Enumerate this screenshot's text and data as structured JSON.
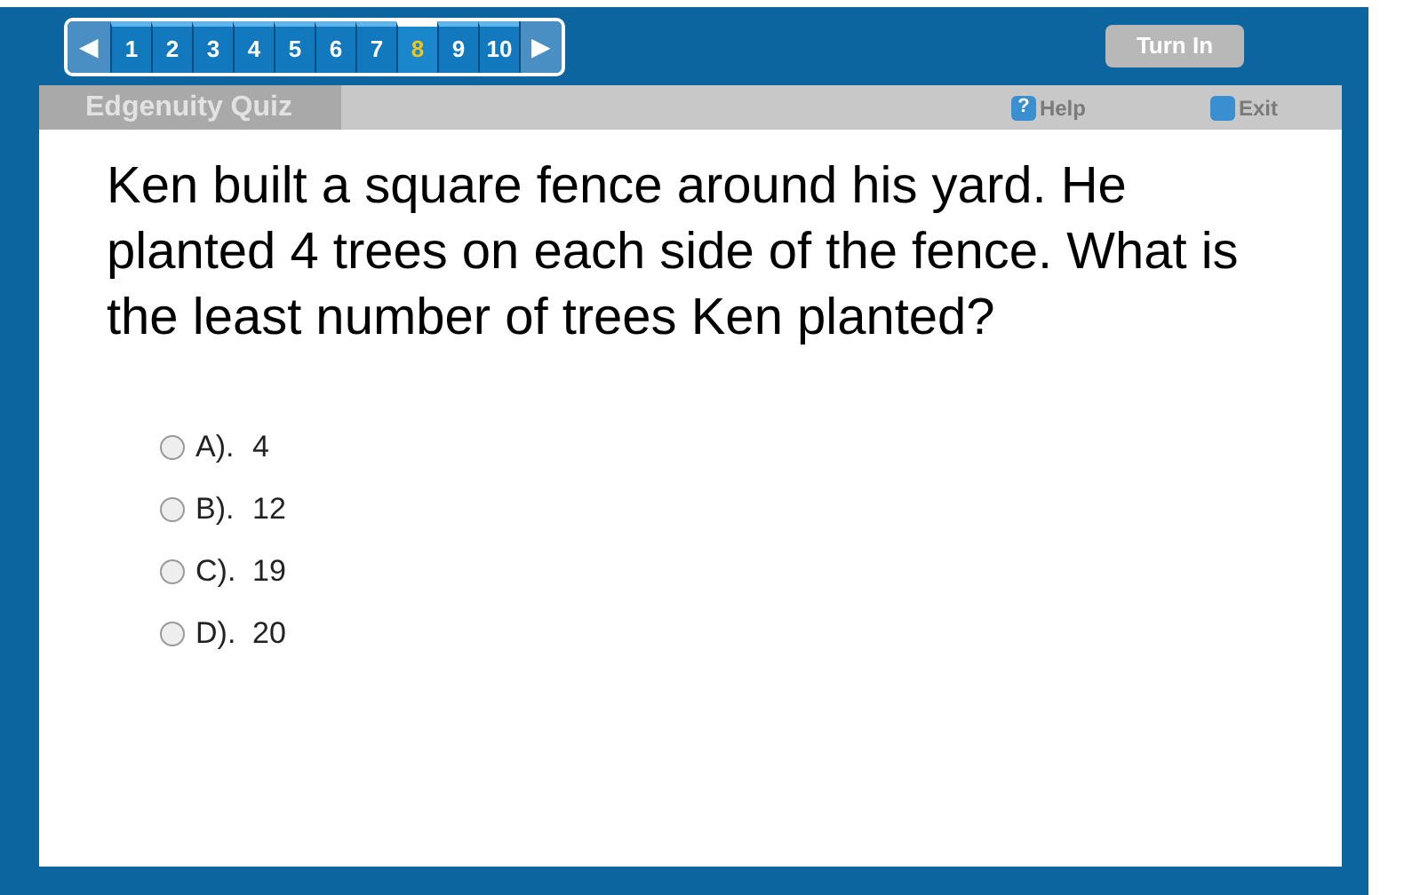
{
  "pager": {
    "prev": "◀",
    "next": "▶",
    "pages": [
      {
        "label": "1",
        "selected": false
      },
      {
        "label": "2",
        "selected": false
      },
      {
        "label": "3",
        "selected": false
      },
      {
        "label": "4",
        "selected": false
      },
      {
        "label": "5",
        "selected": false
      },
      {
        "label": "6",
        "selected": false
      },
      {
        "label": "7",
        "selected": false
      },
      {
        "label": "8",
        "selected": true
      },
      {
        "label": "9",
        "selected": false
      },
      {
        "label": "10",
        "selected": false
      }
    ]
  },
  "turn_in": "Turn In",
  "header": {
    "title": "Edgenuity Quiz",
    "help_icon": "?",
    "help": "Help",
    "exit": "Exit"
  },
  "question": "Ken built a square fence around his yard. He planted 4 trees on each side of the fence. What is the least number of trees Ken planted?",
  "options": [
    {
      "letter": "A).",
      "text": "4",
      "selected": false
    },
    {
      "letter": "B).",
      "text": "12",
      "selected": false
    },
    {
      "letter": "C).",
      "text": "19",
      "selected": false
    },
    {
      "letter": "D).",
      "text": "20",
      "selected": false
    }
  ]
}
